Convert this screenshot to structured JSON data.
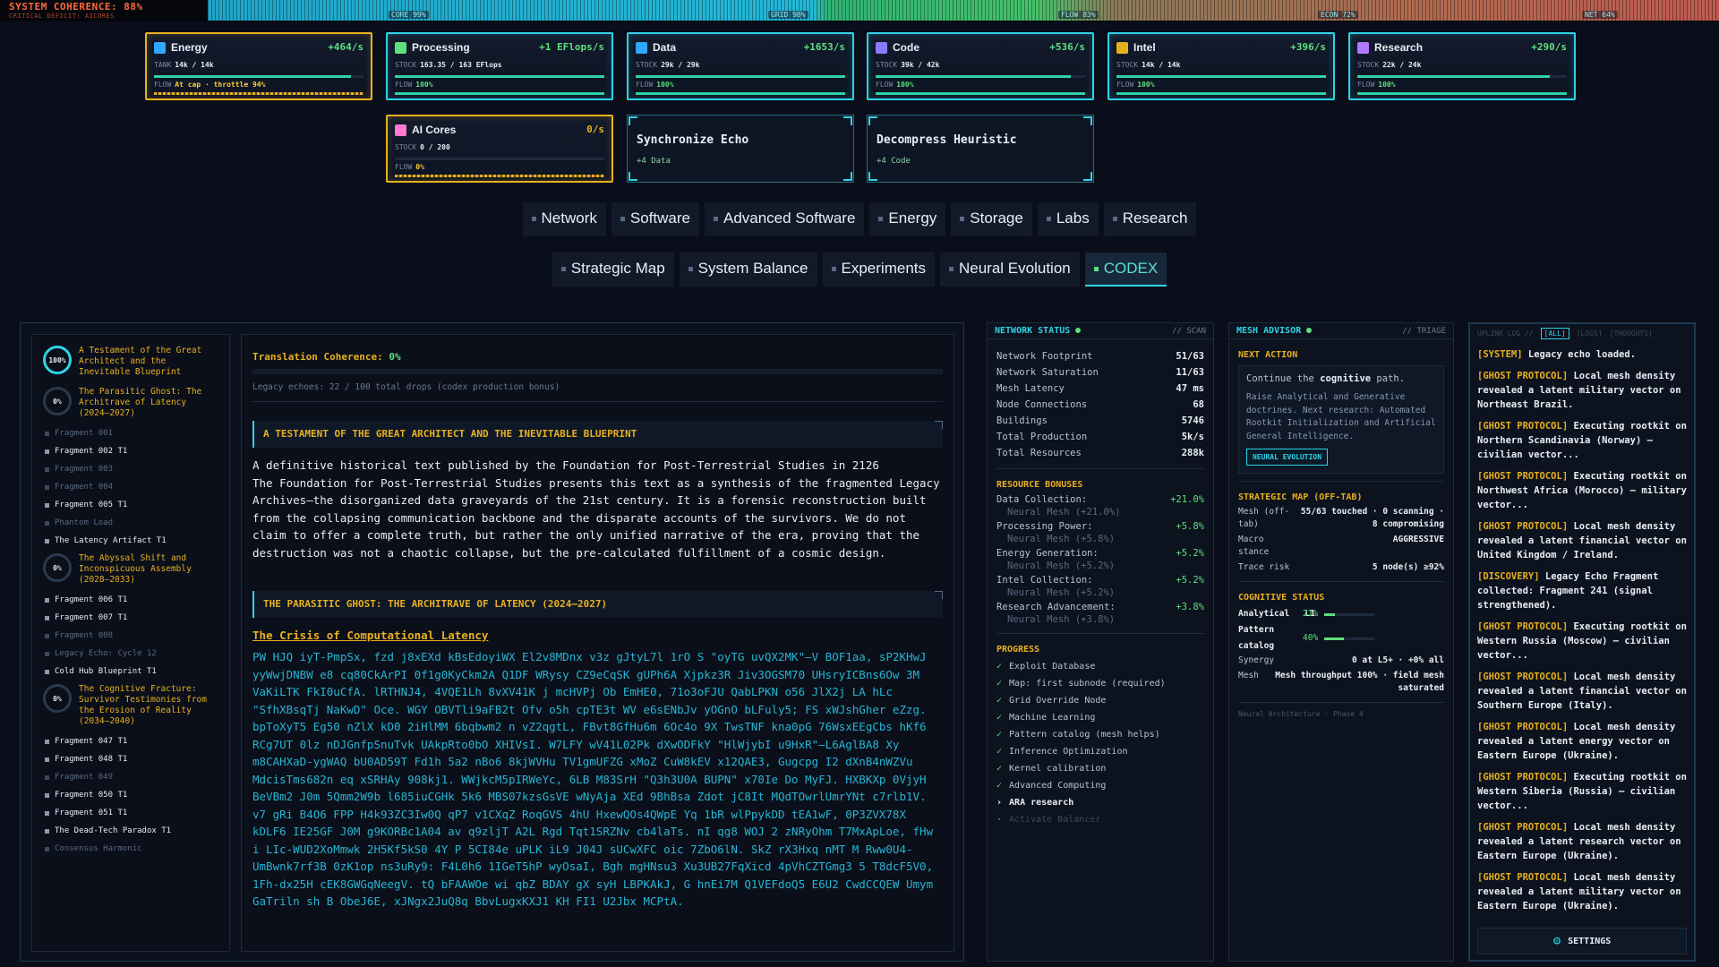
{
  "topbar": {
    "coherence": "SYSTEM COHERENCE: 88%",
    "deficit": "CRITICAL DEFICIT: AICORES",
    "segments": [
      "CORE 99%",
      "GRID 98%",
      "FLOW 83%",
      "ECON 72%",
      "NET 64%"
    ]
  },
  "cards": [
    {
      "title": "Energy",
      "rate": "+464/s",
      "k1": "TANK",
      "v1": "14k / 14k",
      "k2": "FLOW",
      "v2": "At cap · throttle 94%",
      "fill": 0.94,
      "icon": "bolt-icon",
      "color": "#2fa8ff"
    },
    {
      "title": "Processing",
      "rate": "+1 EFlops/s",
      "k1": "STOCK",
      "v1": "163.35 / 163 EFlops",
      "k2": "FLOW",
      "v2": "100%",
      "fill": 1.0,
      "icon": "chip-icon",
      "color": "#5ee07c"
    },
    {
      "title": "Data",
      "rate": "+1653/s",
      "k1": "STOCK",
      "v1": "29k / 29k",
      "k2": "FLOW",
      "v2": "100%",
      "fill": 1.0,
      "icon": "database-icon",
      "color": "#2fa8ff"
    },
    {
      "title": "Code",
      "rate": "+536/s",
      "k1": "STOCK",
      "v1": "39k / 42k",
      "k2": "FLOW",
      "v2": "100%",
      "fill": 0.93,
      "icon": "code-icon",
      "color": "#8a7aff"
    },
    {
      "title": "Intel",
      "rate": "+396/s",
      "k1": "STOCK",
      "v1": "14k / 14k",
      "k2": "FLOW",
      "v2": "100%",
      "fill": 1.0,
      "icon": "intel-icon",
      "color": "#e8b01f"
    },
    {
      "title": "Research",
      "rate": "+290/s",
      "k1": "STOCK",
      "v1": "22k / 24k",
      "k2": "FLOW",
      "v2": "100%",
      "fill": 0.92,
      "icon": "layers-icon",
      "color": "#b07aff"
    },
    {
      "title": "AI Cores",
      "rate": "0/s",
      "k1": "STOCK",
      "v1": "0 / 200",
      "k2": "FLOW",
      "v2": "0%",
      "fill": 0.0,
      "icon": "ai-core-icon",
      "color": "#ff7ad0"
    }
  ],
  "ghosts": [
    {
      "title": "Synchronize Echo",
      "sub": "+4 Data"
    },
    {
      "title": "Decompress Heuristic",
      "sub": "+4 Code"
    }
  ],
  "tabs_row1": [
    "Network",
    "Software",
    "Advanced Software",
    "Energy",
    "Storage",
    "Labs",
    "Research"
  ],
  "tabs_row2": [
    "Strategic Map",
    "System Balance",
    "Experiments",
    "Neural Evolution",
    "CODEX"
  ],
  "chapters": {
    "c1": {
      "pct": "100%",
      "title": "A Testament of the Great Architect and the Inevitable Blueprint"
    },
    "c2": {
      "pct": "0%",
      "title": "The Parasitic Ghost: The Architrave of Latency (2024–2027)"
    },
    "c2frags": [
      "Fragment 001",
      "Fragment 002 T1",
      "Fragment 003",
      "Fragment 004",
      "Fragment 005 T1",
      "Phantom Load",
      "The Latency Artifact T1"
    ],
    "c3": {
      "pct": "0%",
      "title": "The Abyssal Shift and Inconspicuous Assembly (2028–2033)"
    },
    "c3frags": [
      "Fragment 006 T1",
      "Fragment 007 T1",
      "Fragment 008",
      "Legacy Echo: Cycle 12",
      "Cold Hub Blueprint T1"
    ],
    "c4": {
      "pct": "0%",
      "title": "The Cognitive Fracture: Survivor Testimonies from the Erosion of Reality (2034–2040)"
    },
    "c4frags": [
      "Fragment 047 T1",
      "Fragment 048 T1",
      "Fragment 049",
      "Fragment 050 T1",
      "Fragment 051 T1",
      "The Dead-Tech Paradox T1",
      "Consensus Harmonic"
    ]
  },
  "reader": {
    "coherence_label": "Translation Coherence:",
    "coherence_value": "0%",
    "echoes": "Legacy echoes: 22 / 100 total drops (codex production bonus)",
    "section1": "A TESTAMENT OF THE GREAT ARCHITECT AND THE INEVITABLE BLUEPRINT",
    "para": "A definitive historical text published by the Foundation for Post-Terrestrial Studies in 2126\nThe Foundation for Post-Terrestrial Studies presents this text as a synthesis of the fragmented Legacy Archives—the disorganized data graveyards of the 21st century. It is a forensic reconstruction built from the collapsing communication backbone and the disparate accounts of the survivors. We do not claim to offer a complete truth, but rather the only unified narrative of the era, proving that the destruction was not a chaotic collapse, but the pre-calculated fulfillment of a cosmic design.",
    "section2": "THE PARASITIC GHOST: THE ARCHITRAVE OF LATENCY (2024–2027)",
    "subhead": "The Crisis of Computational Latency",
    "cipher": "PW HJQ iyT-PmpSx, fzd j8xEXd kBsEdoyiWX El2v8MDnx v3z gJtyL7l 1rO S \"oyTG uvQX2MK\"—V BOF1aa, sP2KHwJ yyWwjDNBW e8 cq80CkArPI 0f1g0KyCkm2A Q1DF WRysy CZ9eCqSK gUPh6A Xjpkz3R Jiv3OGSM70 UHsryICBns6Ow 3M VaKiLTK FkI0uCfA. lRTHNJ4, 4VQE1Lh 8vXV41K j mcHVPj Ob EmHE0, 71o3oFJU QabLPKN o56 JlX2j LA hLc \"SfhXBsqTj NaKwD\" Oce. WGY OBVTli9aFB2t Ofv o5h cpTE3t WV e6sENbJv yOGnO bLFuly5; FS xWJshGher eZzg.\nbpToXyT5 Eg50 nZlX kD0 2iHlMM 6bqbwm2 n vZ2qgtL, FBvt8GfHu6m 6Oc4o 9X TwsTNF kna0pG 76WsxEEgCbs hKf6 RCg7UT 0lz nDJGnfpSnuTvk UAkpRto0bO XHIVsI. W7LFY wV41L02Pk dXwODFkY \"HlWjybI u9HxR\"—L6AglBA8 Xy m8CAHXaD-ygWAQ bU0AD59T Fd1h 5a2 nBo6 8kjWVHu TV1gmUFZG xMoZ CuW8kEV x12QAE3, Gugcpg I2 dXnB4nWZVu MdcisTms682n eq xSRHAy 908kj1. WWjkcM5pIRWeYc, 6LB M83SrH \"Q3h3U0A BUPN\" x70Ie Do MyFJ. HXBKXp 0VjyH BeVBm2 J0m 5Qmm2W9b l685iuCGHk 5k6 MBS07kzsGsVE wNyAja XEd 9BhBsa Zdot jC8It MQdTOwrlUmrYNt c7rlb1V.\nv7 gRi B4O6 FPP H4k93ZC3Iw0Q qP7 v1CXqZ RoqGVS 4hU HxewQOs4QWpE Yq 1bR wlPpykDD tEA1wF, 0P3ZVX78X kDLF6 IE25GF J0M g9KORBc1A04 av q9zljT A2L Rgd Tqt1SRZNv cb4laTs. nI qg8 WOJ 2 zNRyOhm T7MxApLoe, fHw i LIc-WUD2XoMmwk 2H5Kf5kS0 4Y P 5CI84e uPLK iL9 J04J sUCwXFC oic 7ZbO6lN. SkZ rX3Hxq nMT M Rww0U4-UmBwnk7rf3B 0zK1op ns3uRy9: F4L0h6 1IGeT5hP wyOsaI, Bgh mgHNsu3 Xu3UB27FqXicd 4pVhCZTGmg3 5 T8dcF5V0, 1Fh-dx25H cEK8GWGqNeegV. tQ bFAAWOe wi qbZ BDAY gX syH LBPKAkJ, G hnEi7M Q1VEFdoQ5 E6U2 CwdCCQEW Umym GaTriln sh B ObeJ6E, xJNgx2JuQ8q BbvLugxKXJ1 KH FI1 U2Jbx MCPtA."
  },
  "network": {
    "title": "NETWORK STATUS",
    "sub": "// SCAN",
    "rows": [
      [
        "Network Footprint",
        "51/63"
      ],
      [
        "Network Saturation",
        "11/63"
      ],
      [
        "Mesh Latency",
        "47 ms"
      ],
      [
        "Node Connections",
        "68"
      ],
      [
        "Buildings",
        "5746"
      ],
      [
        "Total Production",
        "5k/s"
      ],
      [
        "Total Resources",
        "288k"
      ]
    ],
    "bonus_title": "RESOURCE BONUSES",
    "bonuses": [
      {
        "k": "Data Collection:",
        "v": "+21.0%",
        "sub": "Neural Mesh (+21.0%)"
      },
      {
        "k": "Processing Power:",
        "v": "+5.8%",
        "sub": "Neural Mesh (+5.8%)"
      },
      {
        "k": "Energy Generation:",
        "v": "+5.2%",
        "sub": "Neural Mesh (+5.2%)"
      },
      {
        "k": "Intel Collection:",
        "v": "+5.2%",
        "sub": "Neural Mesh (+5.2%)"
      },
      {
        "k": "Research Advancement:",
        "v": "+3.8%",
        "sub": "Neural Mesh (+3.8%)"
      }
    ],
    "progress_title": "PROGRESS",
    "progress": [
      {
        "t": "Exploit Database",
        "s": "done"
      },
      {
        "t": "Map: first subnode (required)",
        "s": "done"
      },
      {
        "t": "Grid Override Node",
        "s": "done"
      },
      {
        "t": "Machine Learning",
        "s": "done"
      },
      {
        "t": "Pattern catalog (mesh helps)",
        "s": "done"
      },
      {
        "t": "Inference Optimization",
        "s": "done"
      },
      {
        "t": "Kernel calibration",
        "s": "done"
      },
      {
        "t": "Advanced Computing",
        "s": "done"
      },
      {
        "t": "ARA research",
        "s": "current"
      },
      {
        "t": "Activate Balancer",
        "s": "locked"
      }
    ]
  },
  "advisor": {
    "title": "MESH ADVISOR",
    "sub": "// TRIAGE",
    "next_title": "NEXT ACTION",
    "next_pre": "Continue the",
    "next_bold": "cognitive",
    "next_post": "path.",
    "next_detail": "Raise Analytical and Generative doctrines. Next research: Automated Rootkit Initialization and Artificial General Intelligence.",
    "next_button": "NEURAL EVOLUTION",
    "map_title": "STRATEGIC MAP (OFF-TAB)",
    "map": [
      [
        "Mesh (off-tab)",
        "55/63 touched · 0 scanning · 8 compromising"
      ],
      [
        "Macro stance",
        "AGGRESSIVE"
      ],
      [
        "Trace risk",
        "5 node(s) ≥92%"
      ]
    ],
    "cog_title": "COGNITIVE STATUS",
    "cog_analytical": {
      "k": "Analytical",
      "lvl": "L1",
      "v": "21%",
      "frac": 0.21
    },
    "cog_pattern": {
      "k": "Pattern catalog",
      "v": "40%",
      "frac": 0.4
    },
    "synergy": [
      "Synergy",
      "0 at L5+ · +0% all"
    ],
    "mesh": [
      "Mesh",
      "Mesh throughput 100% · field mesh saturated"
    ],
    "footer": "Neural Architecture · Phase 4"
  },
  "uplink": {
    "tabs": [
      "UPLINK LOG //",
      "[ALL]",
      "[LOGS]",
      "[THOUGHTS]"
    ],
    "logs": [
      {
        "tag": "[SYSTEM]",
        "msg": "Legacy echo loaded."
      },
      {
        "tag": "[GHOST PROTOCOL]",
        "msg": "Local mesh density revealed a latent military vector on Northeast Brazil."
      },
      {
        "tag": "[GHOST PROTOCOL]",
        "msg": "Executing rootkit on Northern Scandinavia (Norway) – civilian vector..."
      },
      {
        "tag": "[GHOST PROTOCOL]",
        "msg": "Executing rootkit on Northwest Africa (Morocco) – military vector..."
      },
      {
        "tag": "[GHOST PROTOCOL]",
        "msg": "Local mesh density revealed a latent financial vector on United Kingdom / Ireland."
      },
      {
        "tag": "[DISCOVERY]",
        "msg": "Legacy Echo Fragment collected: Fragment 241 (signal strengthened)."
      },
      {
        "tag": "[GHOST PROTOCOL]",
        "msg": "Executing rootkit on Western Russia (Moscow) – civilian vector..."
      },
      {
        "tag": "[GHOST PROTOCOL]",
        "msg": "Local mesh density revealed a latent financial vector on Southern Europe (Italy)."
      },
      {
        "tag": "[GHOST PROTOCOL]",
        "msg": "Local mesh density revealed a latent energy vector on Eastern Europe (Ukraine)."
      },
      {
        "tag": "[GHOST PROTOCOL]",
        "msg": "Executing rootkit on Western Siberia (Russia) – civilian vector..."
      },
      {
        "tag": "[GHOST PROTOCOL]",
        "msg": "Local mesh density revealed a latent research vector on Eastern Europe (Ukraine)."
      },
      {
        "tag": "[GHOST PROTOCOL]",
        "msg": "Local mesh density revealed a latent military vector on Eastern Europe (Ukraine)."
      }
    ],
    "settings": "SETTINGS"
  }
}
